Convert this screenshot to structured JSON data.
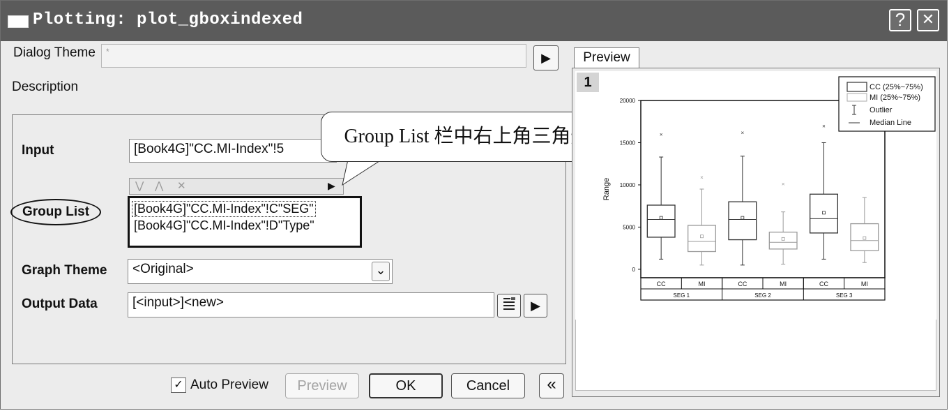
{
  "window": {
    "title": "Plotting: plot_gboxindexed",
    "help_glyph": "?",
    "close_glyph": "✕"
  },
  "dialog_theme": {
    "label": "Dialog Theme",
    "value": "*",
    "arrow_glyph": "▶"
  },
  "description": {
    "label": "Description"
  },
  "input": {
    "label": "Input",
    "value": "[Book4G]\"CC.MI-Index\"!5"
  },
  "group_list": {
    "label": "Group List",
    "toolbar": {
      "down_glyph": "⋁",
      "up_glyph": "⋀",
      "remove_glyph": "✕",
      "arrow_glyph": "▶"
    },
    "items": [
      "[Book4G]\"CC.MI-Index\"!C\"SEG\"",
      "[Book4G]\"CC.MI-Index\"!D\"Type\""
    ]
  },
  "graph_theme": {
    "label": "Graph Theme",
    "value": "<Original>",
    "dropdown_glyph": "⌄"
  },
  "output_data": {
    "label": "Output Data",
    "value": "[<input>]<new>",
    "arrow_glyph": "▶"
  },
  "callout": {
    "text": "Group List 栏中右上角三角形"
  },
  "footer": {
    "auto_preview_label": "Auto Preview",
    "auto_preview_checked": true,
    "preview_button": "Preview",
    "ok_button": "OK",
    "cancel_button": "Cancel",
    "collapse_glyph": "«"
  },
  "preview_panel": {
    "tab_label": "Preview",
    "page_number": "1"
  },
  "chart_data": {
    "type": "box",
    "title": "",
    "ylabel": "Range",
    "ylim": [
      -1000,
      20000
    ],
    "yticks": [
      "20000",
      "15000",
      "10000",
      "5000",
      "0"
    ],
    "ytick_values": [
      20000,
      15000,
      10000,
      5000,
      0
    ],
    "categories": [
      "CC",
      "MI",
      "CC",
      "MI",
      "CC",
      "MI"
    ],
    "groups": [
      "SEG 1",
      "SEG 2",
      "SEG 3"
    ],
    "legend": [
      "CC (25%~75%)",
      "MI (25%~75%)",
      "Outlier",
      "Median Line"
    ],
    "legend_position": "top-right",
    "series": [
      {
        "name": "CC",
        "boxes": [
          {
            "group": "SEG 1",
            "whisker_low": 1200,
            "q1": 3800,
            "median": 5900,
            "q3": 7600,
            "whisker_high": 13300,
            "mean": 6100,
            "outlier": 16000
          },
          {
            "group": "SEG 2",
            "whisker_low": 500,
            "q1": 3500,
            "median": 5900,
            "q3": 8000,
            "whisker_high": 13400,
            "mean": 6100,
            "outlier": 16200
          },
          {
            "group": "SEG 3",
            "whisker_low": 1200,
            "q1": 4300,
            "median": 6000,
            "q3": 8900,
            "whisker_high": 15000,
            "mean": 6700,
            "outlier": 17000
          }
        ]
      },
      {
        "name": "MI",
        "boxes": [
          {
            "group": "SEG 1",
            "whisker_low": 500,
            "q1": 2100,
            "median": 3300,
            "q3": 5200,
            "whisker_high": 9500,
            "mean": 3900,
            "outlier": 10900
          },
          {
            "group": "SEG 2",
            "whisker_low": 600,
            "q1": 2400,
            "median": 3200,
            "q3": 4400,
            "whisker_high": 6800,
            "mean": 3600,
            "outlier": 10100
          },
          {
            "group": "SEG 3",
            "whisker_low": 800,
            "q1": 2200,
            "median": 3400,
            "q3": 5400,
            "whisker_high": 8500,
            "mean": 3700,
            "outlier": null
          }
        ]
      }
    ]
  }
}
